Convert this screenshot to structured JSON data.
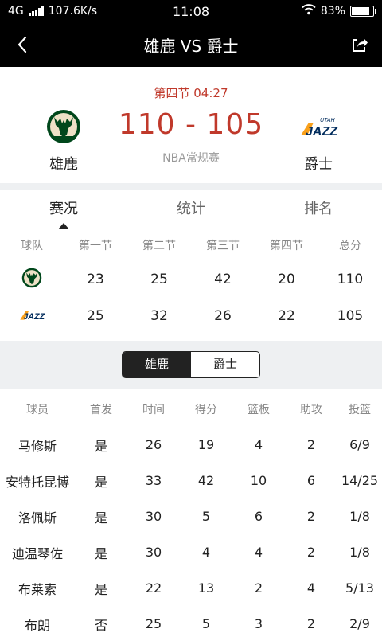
{
  "status": {
    "network": "4G",
    "speed": "107.6K/s",
    "time": "11:08",
    "battery": "83%",
    "battery_level": 0.83
  },
  "nav": {
    "title": "雄鹿 VS 爵士",
    "back_icon": "chevron-left-icon",
    "share_icon": "share-icon"
  },
  "game": {
    "period": "第四节 04:27",
    "score": "110 - 105",
    "league": "NBA常规赛",
    "home": {
      "name": "雄鹿",
      "logo": "bucks-logo"
    },
    "away": {
      "name": "爵士",
      "logo": "jazz-logo",
      "logo_text": "JAZZ",
      "logo_sub": "UTAH"
    }
  },
  "tabs": [
    "赛况",
    "统计",
    "排名"
  ],
  "quarters": {
    "headers": [
      "球队",
      "第一节",
      "第二节",
      "第三节",
      "第四节",
      "总分"
    ],
    "rows": [
      {
        "team": "bucks",
        "values": [
          "23",
          "25",
          "42",
          "20",
          "110"
        ]
      },
      {
        "team": "jazz",
        "values": [
          "25",
          "32",
          "26",
          "22",
          "105"
        ]
      }
    ]
  },
  "team_toggle": [
    "雄鹿",
    "爵士"
  ],
  "players": {
    "headers": [
      "球员",
      "首发",
      "时间",
      "得分",
      "篮板",
      "助攻",
      "投篮"
    ],
    "rows": [
      [
        "马修斯",
        "是",
        "26",
        "19",
        "4",
        "2",
        "6/9"
      ],
      [
        "安特托昆博",
        "是",
        "33",
        "42",
        "10",
        "6",
        "14/25"
      ],
      [
        "洛佩斯",
        "是",
        "30",
        "5",
        "6",
        "2",
        "1/8"
      ],
      [
        "迪温琴佐",
        "是",
        "30",
        "4",
        "4",
        "2",
        "1/8"
      ],
      [
        "布莱索",
        "是",
        "22",
        "13",
        "2",
        "4",
        "5/13"
      ],
      [
        "布朗",
        "否",
        "25",
        "5",
        "3",
        "2",
        "2/9"
      ]
    ]
  },
  "colors": {
    "score_red": "#c0392b",
    "bucks_green": "#00471b",
    "bucks_cream": "#eee1c6",
    "jazz_navy": "#002b5c",
    "jazz_gold": "#f9a01b"
  }
}
